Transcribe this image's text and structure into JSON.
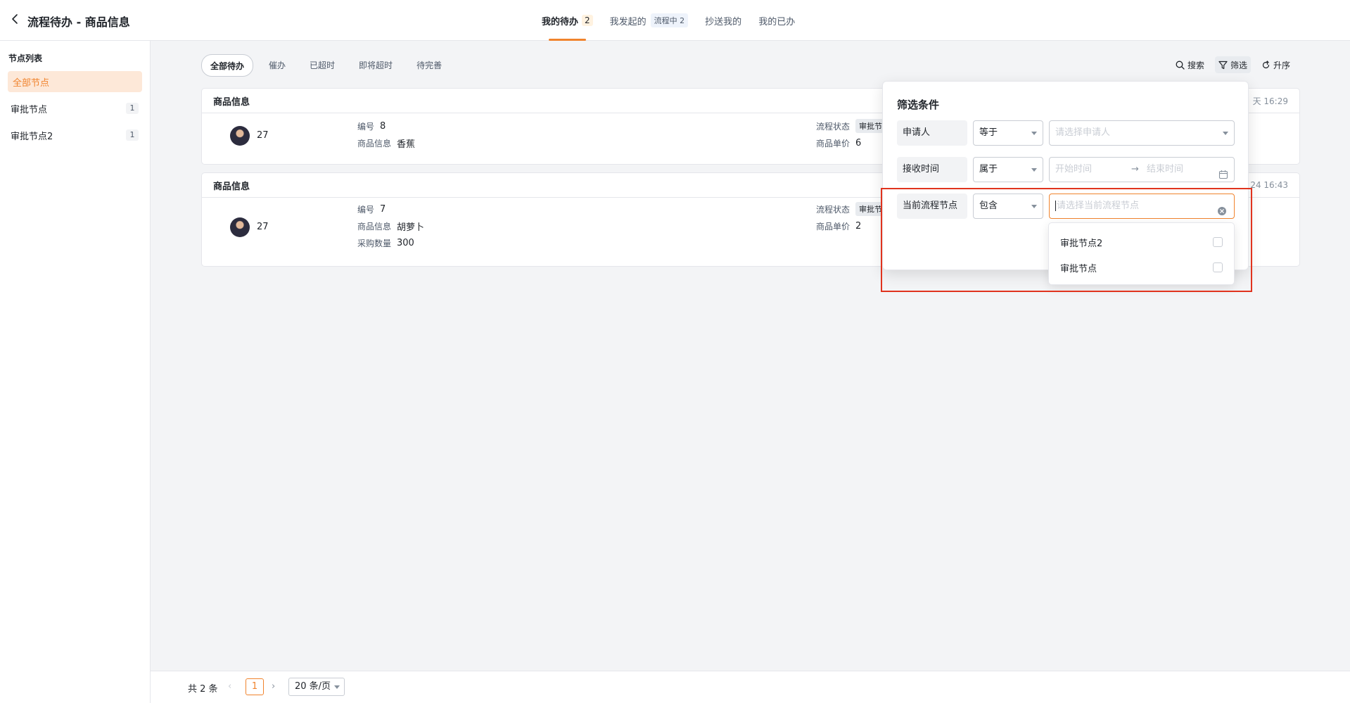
{
  "header": {
    "title": "流程待办 - 商品信息",
    "tabs": [
      {
        "label": "我的待办",
        "badge": "2"
      },
      {
        "label": "我发起的",
        "status": "流程中",
        "badge": "2"
      },
      {
        "label": "抄送我的"
      },
      {
        "label": "我的已办"
      }
    ]
  },
  "sidebar": {
    "title": "节点列表",
    "items": [
      {
        "label": "全部节点"
      },
      {
        "label": "审批节点",
        "count": "1"
      },
      {
        "label": "审批节点2",
        "count": "1"
      }
    ]
  },
  "filters": [
    "全部待办",
    "催办",
    "已超时",
    "即将超时",
    "待完善"
  ],
  "tools": {
    "search": "搜索",
    "filter": "筛选",
    "sort": "升序"
  },
  "cards": [
    {
      "title": "商品信息",
      "time": "天 16:29",
      "user": "27",
      "fields": [
        {
          "k": "编号",
          "v": "8"
        },
        {
          "k": "商品信息",
          "v": "香蕉"
        }
      ],
      "right": [
        {
          "k": "流程状态",
          "v": "审批节"
        },
        {
          "k": "商品单价",
          "v": "6"
        }
      ]
    },
    {
      "title": "商品信息",
      "time": "24 16:43",
      "user": "27",
      "fields": [
        {
          "k": "编号",
          "v": "7"
        },
        {
          "k": "商品信息",
          "v": "胡萝卜"
        },
        {
          "k": "采购数量",
          "v": "300"
        }
      ],
      "right": [
        {
          "k": "流程状态",
          "v": "审批节"
        },
        {
          "k": "商品单价",
          "v": "2"
        }
      ]
    }
  ],
  "popover": {
    "title": "筛选条件",
    "rows": [
      {
        "label": "申请人",
        "op": "等于",
        "placeholder": "请选择申请人"
      },
      {
        "label": "接收时间",
        "op": "属于",
        "start": "开始时间",
        "arrow": "→",
        "end": "结束时间"
      },
      {
        "label": "当前流程节点",
        "op": "包含",
        "placeholder": "请选择当前流程节点"
      }
    ],
    "options": [
      "审批节点2",
      "审批节点"
    ]
  },
  "footer": {
    "total": "共 2 条",
    "prev": "‹",
    "page": "1",
    "next": "›",
    "page_size": "20 条/页"
  },
  "colors": {
    "accent": "#f0832d",
    "highlight": "#e0331e"
  }
}
